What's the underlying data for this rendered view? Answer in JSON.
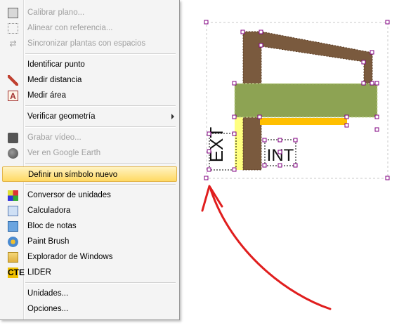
{
  "menu": {
    "items": [
      {
        "label": "Calibrar plano...",
        "icon": "calibrate-icon",
        "enabled": false
      },
      {
        "label": "Alinear con referencia...",
        "icon": "align-icon",
        "enabled": false
      },
      {
        "label": "Sincronizar plantas con espacios",
        "icon": "sync-icon",
        "enabled": false
      },
      {
        "label": "Identificar punto",
        "icon": "",
        "enabled": true
      },
      {
        "label": "Medir distancia",
        "icon": "ruler-icon",
        "enabled": true
      },
      {
        "label": "Medir área",
        "icon": "area-icon",
        "enabled": true
      },
      {
        "label": "Verificar geometría",
        "icon": "",
        "enabled": true,
        "submenu": true
      },
      {
        "label": "Grabar vídeo...",
        "icon": "camera-icon",
        "enabled": false
      },
      {
        "label": "Ver en Google Earth",
        "icon": "globe-icon",
        "enabled": false
      },
      {
        "label": "Definir un símbolo nuevo",
        "icon": "",
        "enabled": true,
        "highlighted": true
      },
      {
        "label": "Conversor de unidades",
        "icon": "unit-converter-icon",
        "enabled": true
      },
      {
        "label": "Calculadora",
        "icon": "calculator-icon",
        "enabled": true
      },
      {
        "label": "Bloc de notas",
        "icon": "notepad-icon",
        "enabled": true
      },
      {
        "label": "Paint Brush",
        "icon": "paint-icon",
        "enabled": true
      },
      {
        "label": "Explorador de Windows",
        "icon": "folder-icon",
        "enabled": true
      },
      {
        "label": "LIDER",
        "icon": "cte-icon",
        "enabled": true,
        "icon_text": "CTE"
      },
      {
        "label": "Unidades...",
        "icon": "",
        "enabled": true
      },
      {
        "label": "Opciones...",
        "icon": "",
        "enabled": true
      }
    ]
  },
  "drawing": {
    "text_ext": "EXT",
    "text_int": "INT",
    "colors": {
      "wall": "#7a5a3e",
      "green": "#8da353",
      "yellow": "#ffff80",
      "orange": "#ffbf00",
      "arrow": "#e01e1e",
      "handle": "#800080"
    }
  }
}
